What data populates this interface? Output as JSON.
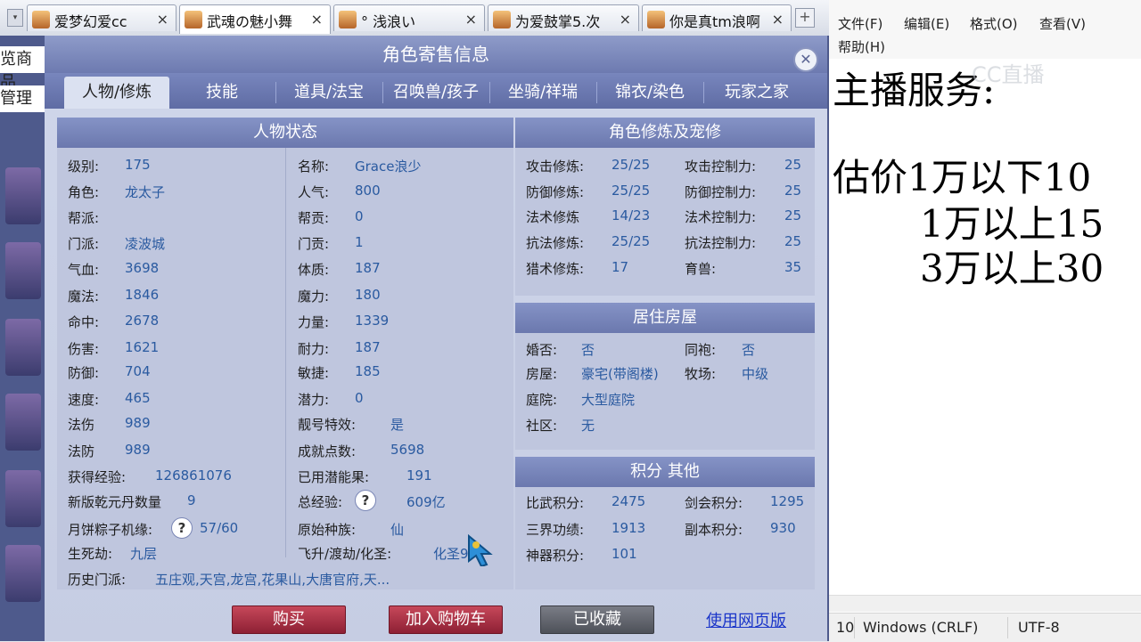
{
  "browser_tabs": [
    {
      "title": "爱梦幻爱cc",
      "close": "×"
    },
    {
      "title": "武魂の魅小舞",
      "close": "×"
    },
    {
      "title": "° 浅浪い",
      "close": "×"
    },
    {
      "title": "为爱鼓掌5.次",
      "close": "×"
    },
    {
      "title": "你是真tm浪啊",
      "close": "×"
    }
  ],
  "new_tab": "+",
  "side_labels": [
    "览商品",
    "管理"
  ],
  "dialog": {
    "title": "角色寄售信息",
    "close": "✕",
    "tabs": [
      "人物/修炼",
      "技能",
      "道具/法宝",
      "召唤兽/孩子",
      "坐骑/祥瑞",
      "锦衣/染色",
      "玩家之家"
    ],
    "status": {
      "header": "人物状态",
      "left": [
        {
          "k": "级别:",
          "v": "175"
        },
        {
          "k": "角色:",
          "v": "龙太子"
        },
        {
          "k": "帮派:",
          "v": ""
        },
        {
          "k": "门派:",
          "v": "凌波城"
        },
        {
          "k": "气血:",
          "v": "3698"
        },
        {
          "k": "魔法:",
          "v": "1846"
        },
        {
          "k": "命中:",
          "v": "2678"
        },
        {
          "k": "伤害:",
          "v": "1621"
        },
        {
          "k": "防御:",
          "v": "704"
        },
        {
          "k": "速度:",
          "v": "465"
        },
        {
          "k": "法伤",
          "v": "989"
        },
        {
          "k": "法防",
          "v": "989"
        },
        {
          "k": "获得经验:",
          "v": "126861076"
        },
        {
          "k": "新版乾元丹数量",
          "v": "9"
        },
        {
          "k": "月饼粽子机缘:",
          "v": "57/60"
        },
        {
          "k": "生死劫:",
          "v": "九层"
        }
      ],
      "right": [
        {
          "k": "名称:",
          "v": "Grace浪少"
        },
        {
          "k": "人气:",
          "v": "800"
        },
        {
          "k": "帮贡:",
          "v": "0"
        },
        {
          "k": "门贡:",
          "v": "1"
        },
        {
          "k": "体质:",
          "v": "187"
        },
        {
          "k": "魔力:",
          "v": "180"
        },
        {
          "k": "力量:",
          "v": "1339"
        },
        {
          "k": "耐力:",
          "v": "187"
        },
        {
          "k": "敏捷:",
          "v": "185"
        },
        {
          "k": "潜力:",
          "v": "0"
        },
        {
          "k": "靓号特效:",
          "v": "是"
        },
        {
          "k": "成就点数:",
          "v": "5698"
        },
        {
          "k": "已用潜能果:",
          "v": "191"
        },
        {
          "k": "总经验:",
          "v": "609亿"
        },
        {
          "k": "原始种族:",
          "v": "仙"
        },
        {
          "k": "飞升/渡劫/化圣:",
          "v": "化圣9"
        }
      ],
      "history_label": "历史门派:",
      "history_value": "五庄观,天宫,龙宫,花果山,大唐官府,天..."
    },
    "cultivation": {
      "header": "角色修炼及宠修",
      "rows": [
        {
          "k1": "攻击修炼:",
          "v1": "25/25",
          "k2": "攻击控制力:",
          "v2": "25"
        },
        {
          "k1": "防御修炼:",
          "v1": "25/25",
          "k2": "防御控制力:",
          "v2": "25"
        },
        {
          "k1": "法术修炼",
          "v1": "14/23",
          "k2": "法术控制力:",
          "v2": "25"
        },
        {
          "k1": "抗法修炼:",
          "v1": "25/25",
          "k2": "抗法控制力:",
          "v2": "25"
        },
        {
          "k1": "猎术修炼:",
          "v1": "17",
          "k2": "育兽:",
          "v2": "35"
        }
      ]
    },
    "housing": {
      "header": "居住房屋",
      "married_k": "婚否:",
      "married_v": "否",
      "sworn_k": "同袍:",
      "sworn_v": "否",
      "house_k": "房屋:",
      "house_v": "豪宅(带阁楼)",
      "ranch_k": "牧场:",
      "ranch_v": "中级",
      "yard_k": "庭院:",
      "yard_v": "大型庭院",
      "community_k": "社区:",
      "community_v": "无"
    },
    "points": {
      "header": "积分 其他",
      "rows": [
        {
          "k1": "比武积分:",
          "v1": "2475",
          "k2": "剑会积分:",
          "v2": "1295"
        },
        {
          "k1": "三界功绩:",
          "v1": "1913",
          "k2": "副本积分:",
          "v2": "930"
        },
        {
          "k1": "神器积分:",
          "v1": "101",
          "k2": "",
          "v2": ""
        }
      ]
    },
    "buttons": {
      "buy": "购买",
      "add_cart": "加入购物车",
      "favorited": "已收藏",
      "web": "使用网页版"
    }
  },
  "notepad": {
    "menu": [
      "文件(F)",
      "编辑(E)",
      "格式(O)",
      "查看(V)",
      "帮助(H)"
    ],
    "watermark": "CC直播",
    "lines": [
      "主播服务:",
      "估价1万以下10",
      "1万以上15",
      "3万以上30"
    ],
    "status": {
      "pos": "10",
      "eol": "Windows (CRLF)",
      "enc": "UTF-8"
    }
  },
  "colors": {
    "dialog_header": "#6d7ab0",
    "value_text": "#2a5aa0",
    "buy_red": "#a8303f",
    "link": "#1a35c9"
  }
}
